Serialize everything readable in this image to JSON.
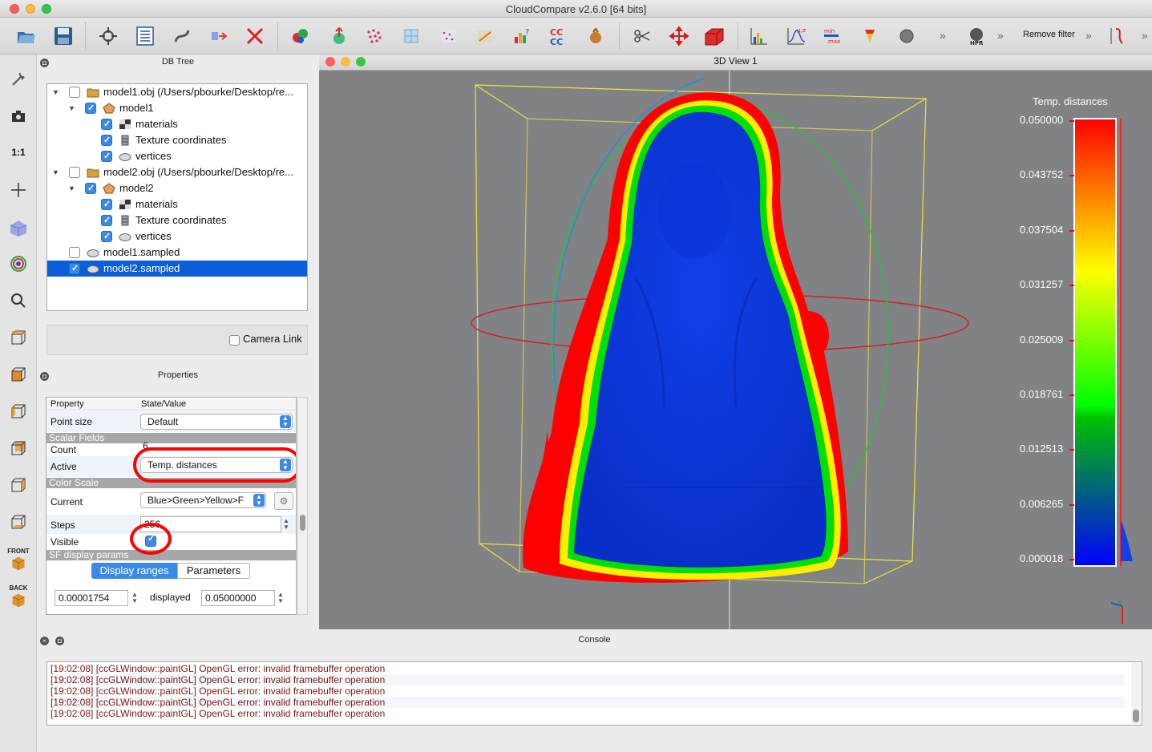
{
  "window": {
    "title": "CloudCompare v2.6.0 [64 bits]"
  },
  "toolbar": {
    "remove_filter_label": "Remove filter"
  },
  "left_toolbar": {
    "ratio_label": "1:1",
    "front_label": "FRONT",
    "back_label": "BACK"
  },
  "db_tree": {
    "header": "DB Tree",
    "items": [
      {
        "label": "model1.obj (/Users/pbourke/Desktop/re...",
        "checked": false,
        "level": 0
      },
      {
        "label": "model1",
        "checked": true,
        "level": 1
      },
      {
        "label": "materials",
        "checked": true,
        "level": 2
      },
      {
        "label": "Texture coordinates",
        "checked": true,
        "level": 2
      },
      {
        "label": "vertices",
        "checked": true,
        "level": 2
      },
      {
        "label": "model2.obj (/Users/pbourke/Desktop/re...",
        "checked": false,
        "level": 0
      },
      {
        "label": "model2",
        "checked": true,
        "level": 1
      },
      {
        "label": "materials",
        "checked": true,
        "level": 2
      },
      {
        "label": "Texture coordinates",
        "checked": true,
        "level": 2
      },
      {
        "label": "vertices",
        "checked": true,
        "level": 2
      },
      {
        "label": "model1.sampled",
        "checked": false,
        "level": 0
      },
      {
        "label": "model2.sampled",
        "checked": true,
        "level": 0,
        "selected": true
      }
    ],
    "camera_link_label": "Camera Link"
  },
  "properties": {
    "header": "Properties",
    "col_property": "Property",
    "col_value": "State/Value",
    "point_size_label": "Point size",
    "point_size_value": "Default",
    "scalar_fields_section": "Scalar Fields",
    "count_label": "Count",
    "count_value": "6",
    "active_label": "Active",
    "active_value": "Temp. distances",
    "color_scale_section": "Color Scale",
    "current_label": "Current",
    "current_value": "Blue>Green>Yellow>F",
    "steps_label": "Steps",
    "steps_value": "256",
    "visible_label": "Visible",
    "sf_display_section": "SF display params",
    "tab_display_ranges": "Display ranges",
    "tab_parameters": "Parameters",
    "range_min": "0.00001754",
    "displayed_label": "displayed",
    "range_max": "0.05000000"
  },
  "view": {
    "header": "3D View 1",
    "scale_title": "Temp. distances",
    "scale_ticks": [
      "0.050000",
      "0.043752",
      "0.037504",
      "0.031257",
      "0.025009",
      "0.018761",
      "0.012513",
      "0.006265",
      "0.000018"
    ]
  },
  "console": {
    "header": "Console",
    "lines": [
      "[19:02:08] [ccGLWindow::paintGL] OpenGL error: invalid framebuffer operation",
      "[19:02:08] [ccGLWindow::paintGL] OpenGL error: invalid framebuffer operation",
      "[19:02:08] [ccGLWindow::paintGL] OpenGL error: invalid framebuffer operation",
      "[19:02:08] [ccGLWindow::paintGL] OpenGL error: invalid framebuffer operation",
      "[19:02:08] [ccGLWindow::paintGL] OpenGL error: invalid framebuffer operation"
    ]
  },
  "colors": {
    "selection": "#0b5ed7",
    "annotation_red": "#ff0000",
    "checkbox_blue": "#3b8ae6"
  }
}
